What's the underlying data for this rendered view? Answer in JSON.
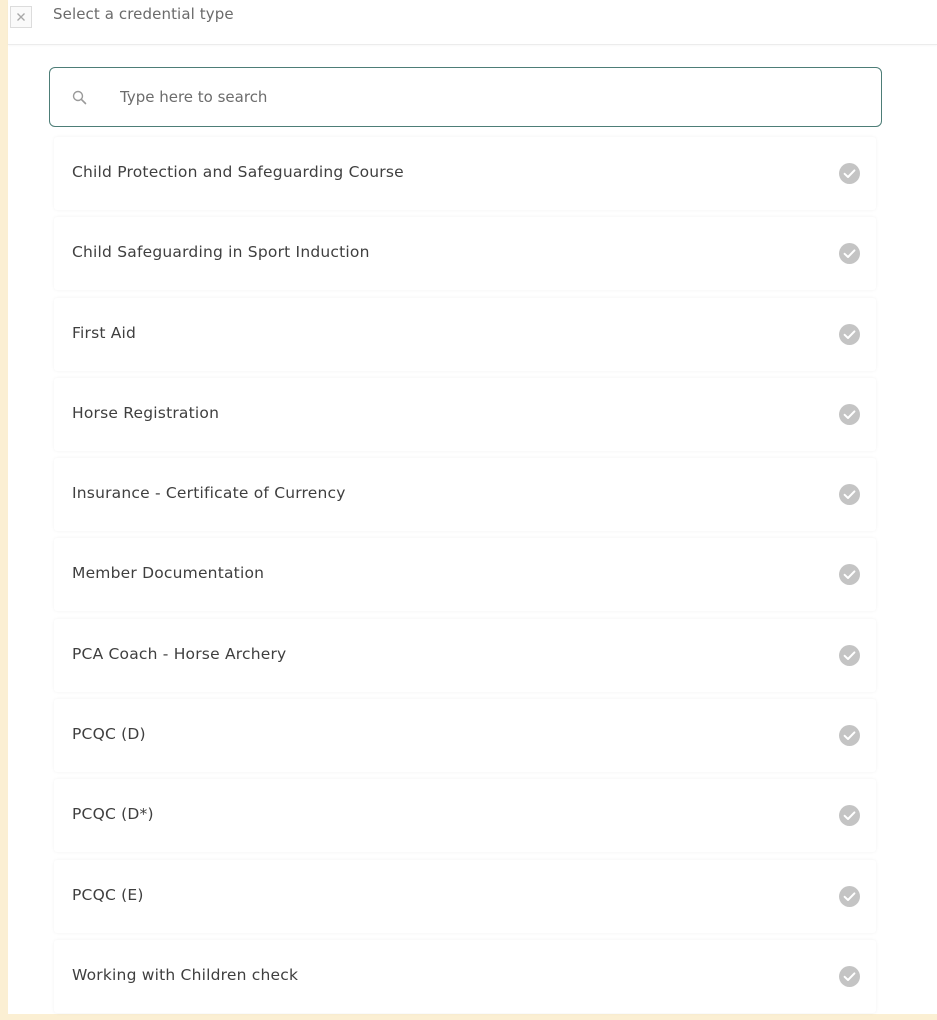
{
  "header": {
    "title": "Select a credential type"
  },
  "search": {
    "placeholder": "Type here to search",
    "value": ""
  },
  "items": [
    {
      "label": "Child Protection and Safeguarding Course"
    },
    {
      "label": "Child Safeguarding in Sport Induction"
    },
    {
      "label": "First Aid"
    },
    {
      "label": "Horse Registration"
    },
    {
      "label": "Insurance - Certificate of Currency"
    },
    {
      "label": "Member Documentation"
    },
    {
      "label": "PCA Coach - Horse Archery"
    },
    {
      "label": "PCQC (D)"
    },
    {
      "label": "PCQC (D*)"
    },
    {
      "label": "PCQC (E)"
    },
    {
      "label": "Working with Children check"
    }
  ],
  "icons": {
    "close": "close-icon",
    "search": "search-icon",
    "check": "check-circle-icon"
  },
  "colors": {
    "background": "#fbefd3",
    "search_border": "#4d7d77",
    "check_circle": "#c4c4c4"
  }
}
